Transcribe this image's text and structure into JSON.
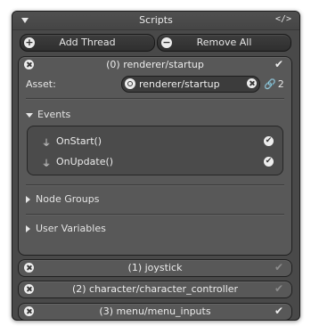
{
  "panel": {
    "title": "Scripts",
    "code_icon": "</>"
  },
  "toolbar": {
    "add_label": "Add Thread",
    "add_icon": "+",
    "remove_label": "Remove All",
    "remove_icon": "−"
  },
  "threads": [
    {
      "name": "(0) renderer/startup",
      "enabled": true,
      "expanded": true,
      "asset_label": "Asset:",
      "asset_value": "renderer/startup",
      "link_count": "2",
      "sections": {
        "events": {
          "label": "Events",
          "items": [
            {
              "label": "OnStart()",
              "checked": true
            },
            {
              "label": "OnUpdate()",
              "checked": true
            }
          ]
        },
        "node_groups": {
          "label": "Node Groups"
        },
        "user_variables": {
          "label": "User Variables"
        }
      }
    },
    {
      "name": "(1) joystick",
      "enabled": false
    },
    {
      "name": "(2) character/character_controller",
      "enabled": false
    },
    {
      "name": "(3) menu/menu_inputs",
      "enabled": true
    }
  ],
  "icons": {
    "check": "✔",
    "event": "⏚",
    "chain": "🔗",
    "remove": "close-icon",
    "goto": "target-icon"
  },
  "colors": {
    "panel_bg": "#494949",
    "thread_bg": "#585858",
    "button_bg": "#333333",
    "text": "#e6e6e6"
  }
}
